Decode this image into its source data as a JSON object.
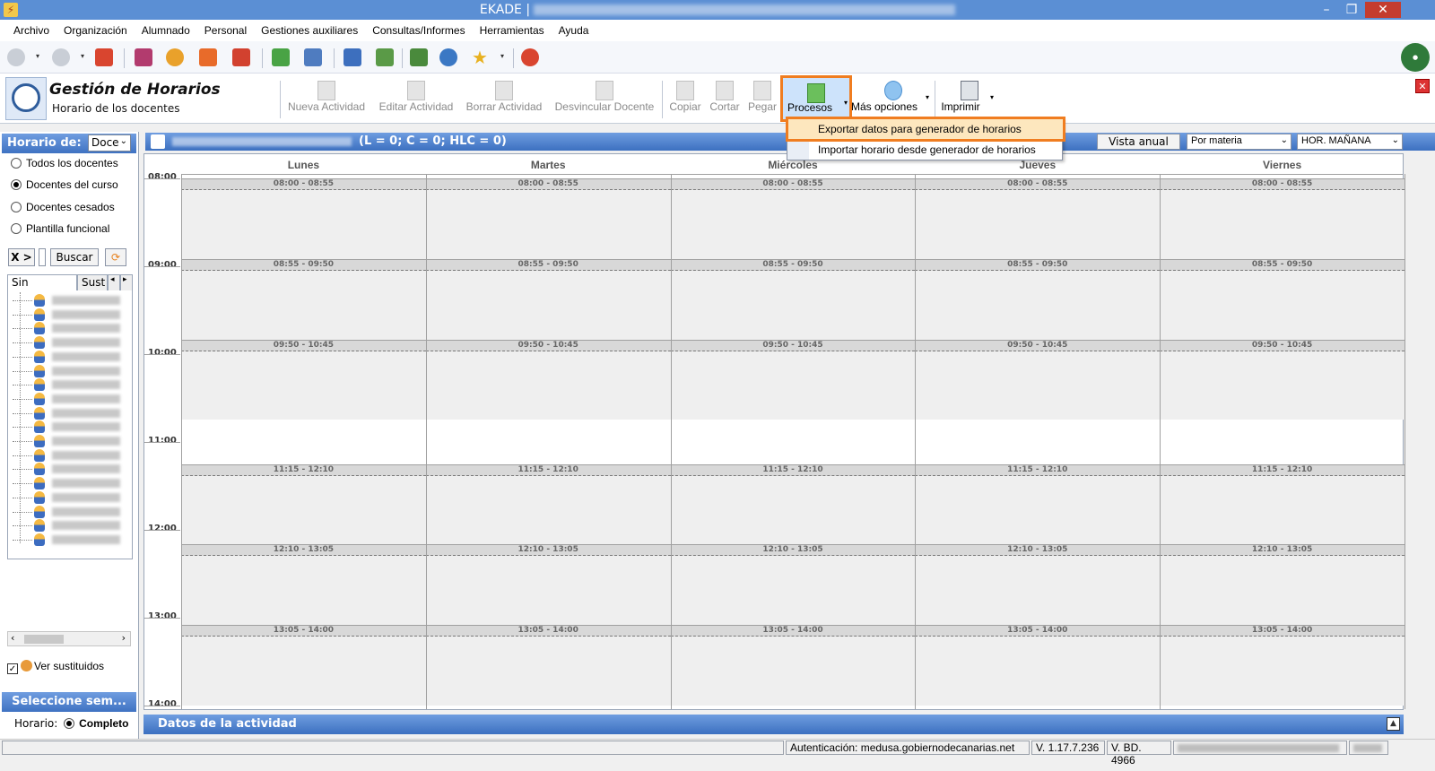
{
  "window": {
    "title": "EKADE |"
  },
  "menu": [
    "Archivo",
    "Organización",
    "Alumnado",
    "Personal",
    "Gestiones auxiliares",
    "Consultas/Informes",
    "Herramientas",
    "Ayuda"
  ],
  "module": {
    "title": "Gestión de Horarios",
    "subtitle": "Horario de los docentes"
  },
  "ribbon": {
    "nueva": "Nueva Actividad",
    "editar": "Editar Actividad",
    "borrar": "Borrar Actividad",
    "desvincular": "Desvincular Docente",
    "copiar": "Copiar",
    "cortar": "Cortar",
    "pegar": "Pegar",
    "procesos": "Procesos",
    "mas": "Más opciones",
    "imprimir": "Imprimir"
  },
  "procesos_menu": {
    "export": "Exportar datos para generador de horarios",
    "import": "Importar horario desde generador de horarios"
  },
  "left": {
    "header": "Horario de:",
    "select_value": "Doce",
    "radios": [
      "Todos los docentes",
      "Docentes del curso",
      "Docentes cesados",
      "Plantilla funcional"
    ],
    "selected_radio": 1,
    "clear_btn": "X >",
    "search_btn": "Buscar",
    "tab1": "Sin agrupar",
    "tab2": "Sust",
    "ver_sustituidos": "Ver sustituidos",
    "seleccione": "Seleccione sem...",
    "horario_label": "Horario:",
    "horario_value": "Completo"
  },
  "schedule": {
    "counts": "(L = 0; C = 0; HLC = 0)",
    "vista_anual": "Vista anual",
    "por_materia": "Por materia",
    "turno": "HOR. MAÑANA",
    "days": [
      "Lunes",
      "Martes",
      "Miércoles",
      "Jueves",
      "Viernes"
    ],
    "hours": [
      "08:00",
      "09:00",
      "10:00",
      "11:00",
      "12:00",
      "13:00",
      "14:00"
    ],
    "slots": [
      "08:00 - 08:55",
      "08:55 - 09:50",
      "09:50 - 10:45",
      "11:15 - 12:10",
      "12:10 - 13:05",
      "13:05 - 14:00"
    ],
    "datos_actividad": "Datos de la actividad"
  },
  "status": {
    "auth": "Autenticación: medusa.gobiernodecanarias.net",
    "version": "V. 1.17.7.236",
    "bd": "V. BD. 4966"
  },
  "colors": {
    "accent": "#3f72c2",
    "highlight": "#f07d20"
  }
}
